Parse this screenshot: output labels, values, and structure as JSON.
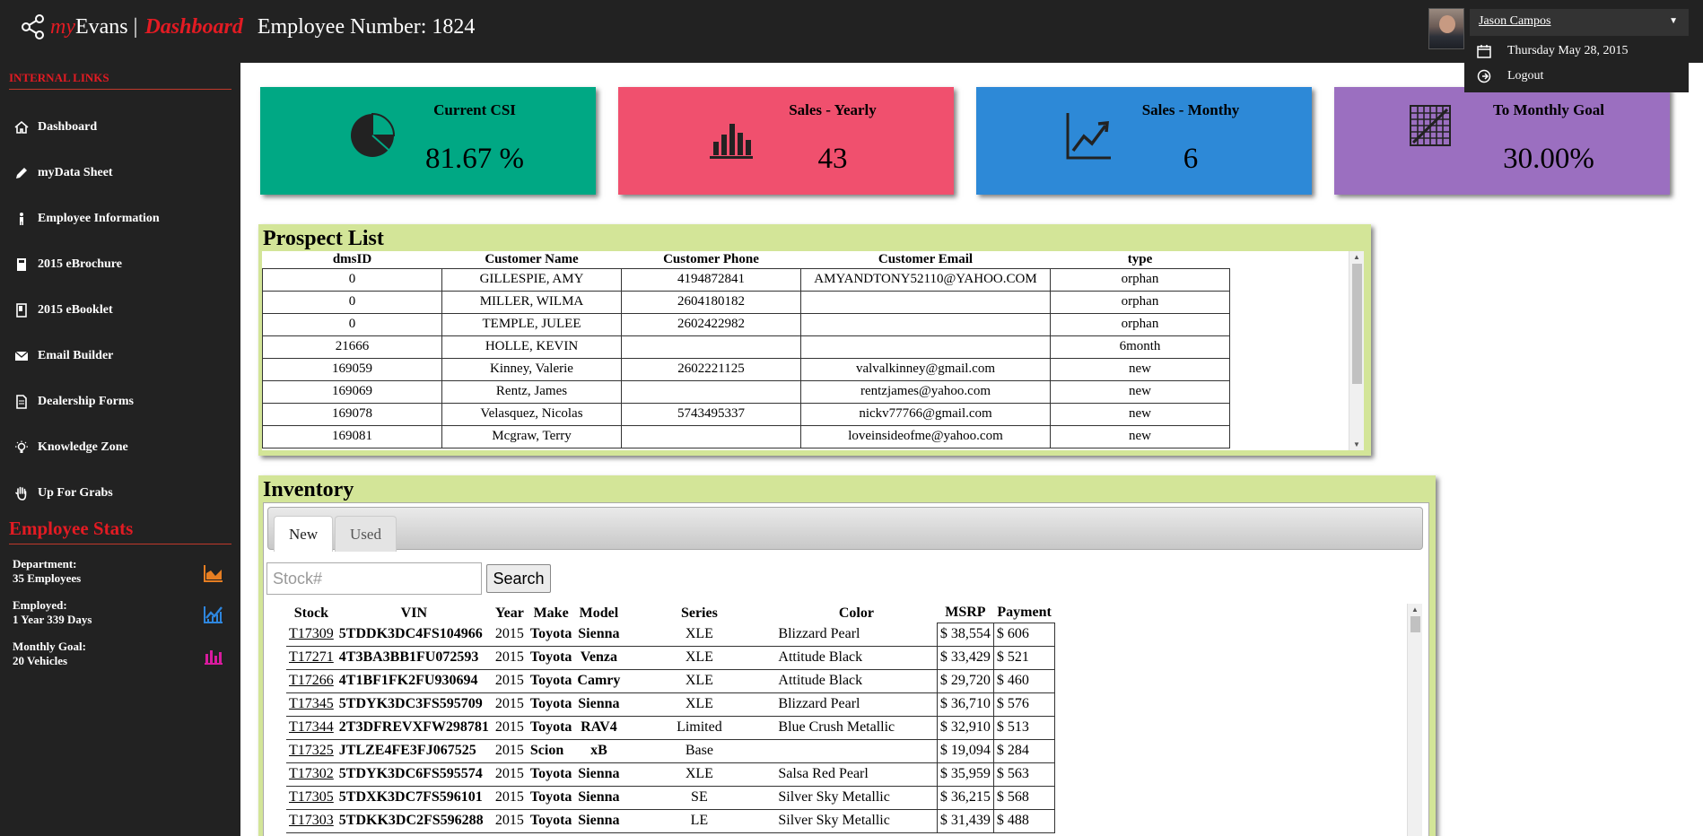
{
  "header": {
    "brand_my": "my",
    "brand_evans": "Evans |",
    "brand_dashboard": "Dashboard",
    "employee_number": "Employee Number: 1824",
    "user_name": "Jason Campos",
    "date": "Thursday May 28, 2015",
    "logout_label": "Logout",
    "icons": [
      "share-icon",
      "calendar-icon",
      "logout-icon",
      "caret-down-icon"
    ]
  },
  "sidebar": {
    "section_title": "INTERNAL LINKS",
    "items": [
      {
        "label": "Dashboard",
        "icon": "home-icon"
      },
      {
        "label": "myData Sheet",
        "icon": "pencil-icon"
      },
      {
        "label": "Employee Information",
        "icon": "person-icon"
      },
      {
        "label": "2015 eBrochure",
        "icon": "book-icon"
      },
      {
        "label": "2015 eBooklet",
        "icon": "booklet-icon"
      },
      {
        "label": "Email Builder",
        "icon": "envelope-icon"
      },
      {
        "label": "Dealership Forms",
        "icon": "document-icon"
      },
      {
        "label": "Knowledge Zone",
        "icon": "lightbulb-icon"
      },
      {
        "label": "Up For Grabs",
        "icon": "hand-icon"
      }
    ],
    "stats_title": "Employee Stats",
    "stats": [
      {
        "line1": "Department:",
        "line2": "35 Employees",
        "icon": "area-chart-icon",
        "color": "#e67e22"
      },
      {
        "line1": "Employed:",
        "line2": "1 Year 339 Days",
        "icon": "line-chart-icon",
        "color": "#2e86de"
      },
      {
        "line1": "Monthly Goal:",
        "line2": "20 Vehicles",
        "icon": "bar-chart-icon",
        "color": "#d81b9e"
      }
    ]
  },
  "tiles": [
    {
      "title": "Current CSI",
      "value": "81.67 %",
      "color": "#00a884",
      "icon": "pie-chart-icon"
    },
    {
      "title": "Sales - Yearly",
      "value": "43",
      "color": "#f0506e",
      "icon": "bar-chart-icon"
    },
    {
      "title": "Sales - Monthy",
      "value": "6",
      "color": "#2d89d7",
      "icon": "trend-chart-icon"
    },
    {
      "title": "To Monthly Goal",
      "value": "30.00%",
      "color": "#9b6fc0",
      "icon": "grid-chart-icon"
    }
  ],
  "prospect": {
    "title": "Prospect List",
    "columns": [
      "dmsID",
      "Customer Name",
      "Customer Phone",
      "Customer Email",
      "type"
    ],
    "rows": [
      [
        "0",
        "GILLESPIE, AMY",
        "4194872841",
        "AMYANDTONY52110@YAHOO.COM",
        "orphan"
      ],
      [
        "0",
        "MILLER, WILMA",
        "2604180182",
        "",
        "orphan"
      ],
      [
        "0",
        "TEMPLE, JULEE",
        "2602422982",
        "",
        "orphan"
      ],
      [
        "21666",
        "HOLLE, KEVIN",
        "",
        "",
        "6month"
      ],
      [
        "169059",
        "Kinney, Valerie",
        "2602221125",
        "valvalkinney@gmail.com",
        "new"
      ],
      [
        "169069",
        "Rentz, James",
        "",
        "rentzjames@yahoo.com",
        "new"
      ],
      [
        "169078",
        "Velasquez, Nicolas",
        "5743495337",
        "nickv77766@gmail.com",
        "new"
      ],
      [
        "169081",
        "Mcgraw, Terry",
        "",
        "loveinsideofme@yahoo.com",
        "new"
      ]
    ]
  },
  "inventory": {
    "title": "Inventory",
    "tabs": [
      "New",
      "Used"
    ],
    "search_placeholder": "Stock#",
    "search_label": "Search",
    "columns": [
      "Stock",
      "VIN",
      "Year",
      "Make",
      "Model",
      "Series",
      "Color",
      "MSRP",
      "Payment"
    ],
    "rows": [
      [
        "T17309",
        "5TDDK3DC4FS104966",
        "2015",
        "Toyota",
        "Sienna",
        "XLE",
        "Blizzard Pearl",
        "$ 38,554",
        "$ 606"
      ],
      [
        "T17271",
        "4T3BA3BB1FU072593",
        "2015",
        "Toyota",
        "Venza",
        "XLE",
        "Attitude Black",
        "$ 33,429",
        "$ 521"
      ],
      [
        "T17266",
        "4T1BF1FK2FU930694",
        "2015",
        "Toyota",
        "Camry",
        "XLE",
        "Attitude Black",
        "$ 29,720",
        "$ 460"
      ],
      [
        "T17345",
        "5TDYK3DC3FS595709",
        "2015",
        "Toyota",
        "Sienna",
        "XLE",
        "Blizzard Pearl",
        "$ 36,710",
        "$ 576"
      ],
      [
        "T17344",
        "2T3DFREVXFW298781",
        "2015",
        "Toyota",
        "RAV4",
        "Limited",
        "Blue Crush Metallic",
        "$ 32,910",
        "$ 513"
      ],
      [
        "T17325",
        "JTLZE4FE3FJ067525",
        "2015",
        "Scion",
        "xB",
        "Base",
        "",
        "$ 19,094",
        "$ 284"
      ],
      [
        "T17302",
        "5TDYK3DC6FS595574",
        "2015",
        "Toyota",
        "Sienna",
        "XLE",
        "Salsa Red Pearl",
        "$ 35,959",
        "$ 563"
      ],
      [
        "T17305",
        "5TDXK3DC7FS596101",
        "2015",
        "Toyota",
        "Sienna",
        "SE",
        "Silver Sky Metallic",
        "$ 36,215",
        "$ 568"
      ],
      [
        "T17303",
        "5TDKK3DC2FS596288",
        "2015",
        "Toyota",
        "Sienna",
        "LE",
        "Silver Sky Metallic",
        "$ 31,439",
        "$ 488"
      ]
    ]
  }
}
